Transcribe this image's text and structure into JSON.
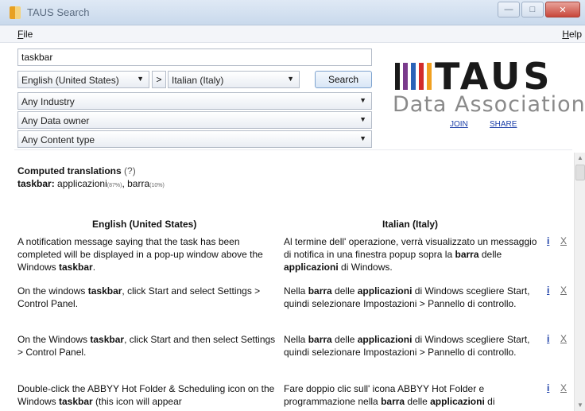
{
  "window": {
    "title": "TAUS Search",
    "minimize": "—",
    "maximize": "□",
    "close": "✕"
  },
  "menu": {
    "file": "File",
    "help": "Help"
  },
  "search": {
    "query": "taskbar",
    "source_language": "English (United States)",
    "target_language": "Italian (Italy)",
    "swap_label": ">",
    "button_label": "Search",
    "industry": "Any Industry",
    "data_owner": "Any Data owner",
    "content_type": "Any Content type"
  },
  "logo": {
    "wordmark": "TAUS",
    "subtitle": "Data Association",
    "bar_colors": [
      "#1a1a1a",
      "#7a3a8c",
      "#2a63b8",
      "#d22b2b",
      "#f0a020"
    ]
  },
  "links": {
    "join": "JOIN",
    "share": "SHARE"
  },
  "computed": {
    "title": "Computed translations",
    "help": "(?)",
    "term": "taskbar:",
    "translation_1": "applicazioni",
    "translation_1_pct": "(87%)",
    "separator": ", ",
    "translation_2": "barra",
    "translation_2_pct": "(10%)"
  },
  "columns": {
    "source": "English (United States)",
    "target": "Italian (Italy)"
  },
  "rows": [
    {
      "en": [
        "A notification message saying that the task has been completed will be displayed in a pop-up window above the Windows ",
        "taskbar",
        "."
      ],
      "it": [
        "Al termine dell' operazione, verrà visualizzato un messaggio di notifica in una finestra popup sopra la ",
        "barra",
        " delle ",
        "applicazioni",
        " di Windows."
      ],
      "info": "i",
      "remove": "X"
    },
    {
      "en": [
        "On the windows ",
        "taskbar",
        ", click Start and select Settings > Control Panel."
      ],
      "it": [
        "Nella ",
        "barra",
        " delle ",
        "applicazioni",
        " di Windows scegliere Start, quindi selezionare Impostazioni > Pannello di controllo."
      ],
      "info": "i",
      "remove": "X"
    },
    {
      "en": [
        "On the Windows ",
        "taskbar",
        ", click Start and then select Settings > Control Panel."
      ],
      "it": [
        "Nella ",
        "barra",
        " delle ",
        "applicazioni",
        " di Windows scegliere Start, quindi selezionare Impostazioni > Pannello di controllo."
      ],
      "info": "i",
      "remove": "X"
    },
    {
      "en": [
        "Double-click the ABBYY Hot Folder & Scheduling icon on the Windows ",
        "taskbar",
        " (this icon will appear"
      ],
      "it": [
        "Fare doppio clic sull' icona ABBYY Hot Folder e programmazione nella ",
        "barra",
        " delle ",
        "applicazioni",
        " di"
      ],
      "info": "i",
      "remove": "X"
    }
  ],
  "scrollbar": {
    "up": "▲",
    "down": "▼"
  }
}
